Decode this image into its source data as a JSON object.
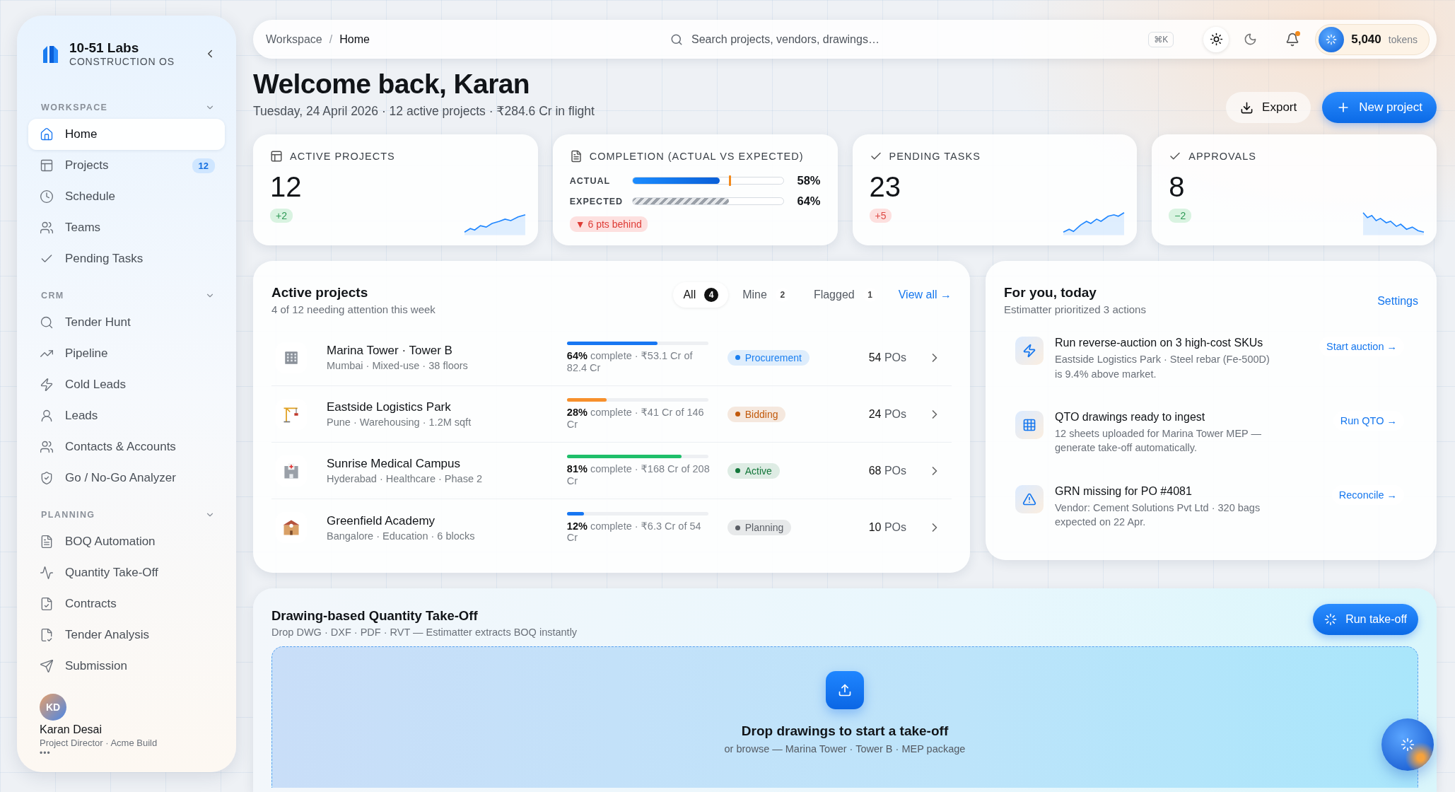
{
  "brand": {
    "name": "10-51 Labs",
    "tagline": "CONSTRUCTION OS"
  },
  "sidebar": {
    "sections": [
      {
        "title": "WORKSPACE",
        "expanded": true,
        "items": [
          {
            "label": "Home",
            "selected": true
          },
          {
            "label": "Projects",
            "badge": "12",
            "selected": false
          },
          {
            "label": "Schedule",
            "selected": false
          },
          {
            "label": "Teams",
            "selected": false
          },
          {
            "label": "Pending Tasks",
            "selected": false
          }
        ]
      },
      {
        "title": "CRM",
        "expanded": true,
        "items": [
          {
            "label": "Tender Hunt",
            "selected": false
          },
          {
            "label": "Pipeline",
            "selected": false
          },
          {
            "label": "Cold Leads",
            "selected": false
          },
          {
            "label": "Leads",
            "selected": false
          },
          {
            "label": "Contacts & Accounts",
            "selected": false
          },
          {
            "label": "Go / No-Go Analyzer",
            "selected": false
          }
        ]
      },
      {
        "title": "PLANNING",
        "expanded": true,
        "items": [
          {
            "label": "BOQ Automation",
            "selected": false
          },
          {
            "label": "Quantity Take-Off",
            "selected": false
          },
          {
            "label": "Contracts",
            "selected": false
          },
          {
            "label": "Tender Analysis",
            "selected": false
          },
          {
            "label": "Submission",
            "selected": false
          }
        ]
      }
    ],
    "user": {
      "initials": "KD",
      "name": "Karan Desai",
      "role": "Project Director · Acme Build",
      "more": "•••"
    }
  },
  "topbar": {
    "breadcrumb": [
      "Workspace",
      "Home"
    ],
    "separator": "/",
    "search": {
      "placeholder": "Search projects, vendors, drawings…",
      "shortcut": "⌘K"
    },
    "dark_mode": false,
    "notifications_unread": true,
    "tokens": {
      "value": "5,040",
      "unit": "tokens"
    }
  },
  "header": {
    "title": "Welcome back, Karan",
    "subtitle": "Tuesday, 24 April 2026 · 12 active projects · ₹284.6 Cr in flight",
    "actions": [
      {
        "label": "Export",
        "kind": "secondary"
      },
      {
        "label": "New project",
        "kind": "primary"
      }
    ]
  },
  "kpis": [
    {
      "kind": "stat",
      "label": "ACTIVE PROJECTS",
      "value": "12",
      "delta": "+2",
      "positive": true
    },
    {
      "kind": "completion",
      "label": "COMPLETION (ACTUAL VS EXPECTED)",
      "rows": [
        {
          "label": "ACTUAL",
          "level": 0.58,
          "reading": "58%"
        },
        {
          "label": "EXPECTED",
          "level": 0.64,
          "reading": "64%"
        }
      ],
      "alert": "▼ 6 pts behind"
    },
    {
      "kind": "stat",
      "label": "PENDING TASKS",
      "value": "23",
      "delta": "+5",
      "positive": false
    },
    {
      "kind": "stat",
      "label": "APPROVALS",
      "value": "8",
      "delta": "−2",
      "positive": true
    }
  ],
  "projects": {
    "title": "Active projects",
    "subtitle": "4 of 12 needing attention this week",
    "filters": [
      {
        "label": "All",
        "count": "4",
        "selected": true
      },
      {
        "label": "Mine",
        "count": "2",
        "selected": false
      },
      {
        "label": "Flagged",
        "count": "1",
        "selected": false
      }
    ],
    "link": "View all →",
    "rows": [
      {
        "name": "Marina Tower · Tower B",
        "meta": "Mumbai · Mixed-use · 38 floors",
        "level": 0.64,
        "color": "#1877f2",
        "progress": "**64%** complete · ₹53.1 Cr of 82.4 Cr",
        "status": {
          "label": "Procurement",
          "color": "#1a7ff0"
        },
        "pos": "**54** POs"
      },
      {
        "name": "Eastside Logistics Park",
        "meta": "Pune · Warehousing · 1.2M sqft",
        "level": 0.28,
        "color": "#f7902c",
        "progress": "**28%** complete · ₹41 Cr of 146 Cr",
        "status": {
          "label": "Bidding",
          "color": "#c25a0c"
        },
        "pos": "**24** POs"
      },
      {
        "name": "Sunrise Medical Campus",
        "meta": "Hyderabad · Healthcare · Phase 2",
        "level": 0.81,
        "color": "#1fbf6a",
        "progress": "**81%** complete · ₹168 Cr of 208 Cr",
        "status": {
          "label": "Active",
          "color": "#13773a"
        },
        "pos": "**68** POs"
      },
      {
        "name": "Greenfield Academy",
        "meta": "Bangalore · Education · 6 blocks",
        "level": 0.12,
        "color": "#1877f2",
        "progress": "**12%** complete · ₹6.3 Cr of 54 Cr",
        "status": {
          "label": "Planning",
          "color": "#5b5f66"
        },
        "pos": "**10** POs"
      }
    ]
  },
  "for_you": {
    "title": "For you, today",
    "subtitle": "Estimatter prioritized 3 actions",
    "link": "Settings",
    "actions": [
      {
        "title": "Run reverse-auction on 3 high-cost SKUs",
        "detail": "Eastside Logistics Park · Steel rebar (Fe-500D) is 9.4% above market.",
        "cta": "Start auction →"
      },
      {
        "title": "QTO drawings ready to ingest",
        "detail": "12 sheets uploaded for Marina Tower MEP — generate take-off automatically.",
        "cta": "Run QTO →"
      },
      {
        "title": "GRN missing for PO #4081",
        "detail": "Vendor: Cement Solutions Pvt Ltd · 320 bags expected on 22 Apr.",
        "cta": "Reconcile →"
      }
    ]
  },
  "takeoff": {
    "title": "Drawing-based Quantity Take-Off",
    "subtitle": "Drop DWG · DXF · PDF · RVT — Estimatter extracts BOQ instantly",
    "button": "Run take-off",
    "drop_title": "Drop drawings to start a take-off",
    "drop_hint": "or browse — Marina Tower · Tower B · MEP package"
  }
}
